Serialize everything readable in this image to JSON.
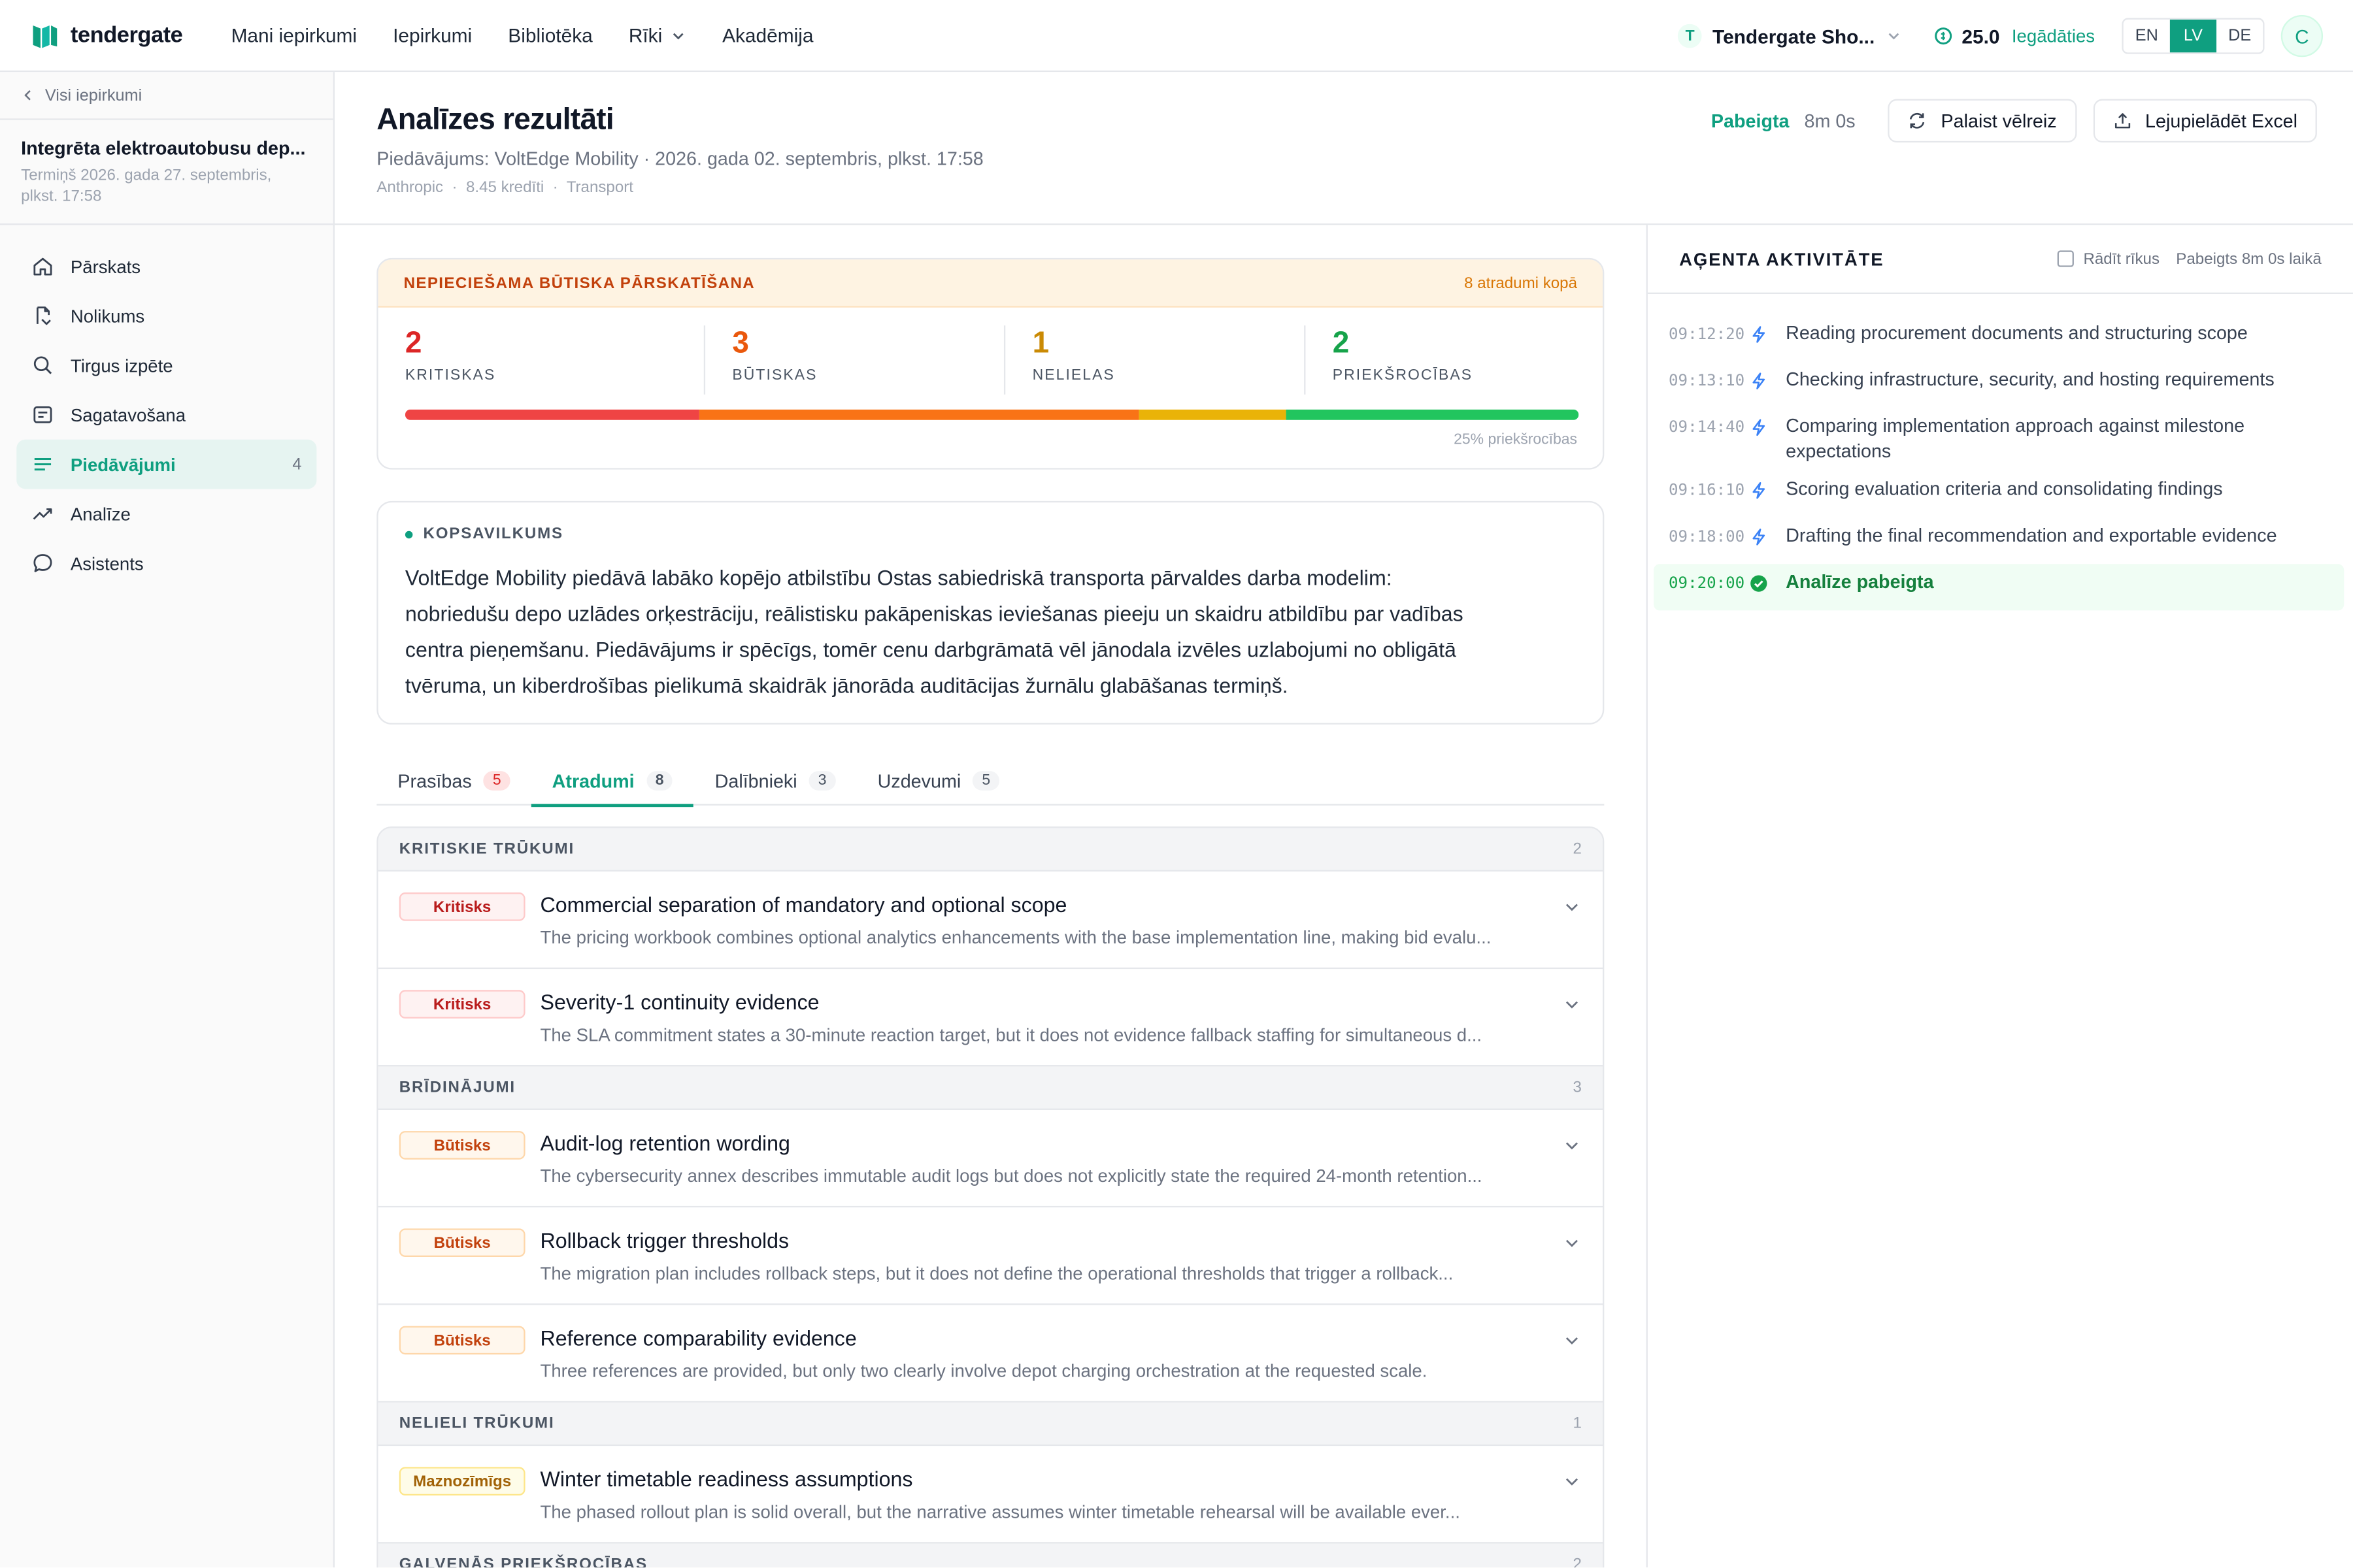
{
  "brand": {
    "name": "tendergate"
  },
  "nav": {
    "items": [
      "Mani iepirkumi",
      "Iepirkumi",
      "Bibliotēka",
      "Rīki",
      "Akadēmija"
    ]
  },
  "topright": {
    "org_initial": "T",
    "org_name": "Tendergate Sho...",
    "credits": "25.0",
    "topup": "Iegādāties",
    "langs": [
      "EN",
      "LV",
      "DE"
    ],
    "active_lang": "LV",
    "avatar": "C"
  },
  "sidebar": {
    "back": "Visi iepirkumi",
    "tender_title": "Integrēta elektroautobusu dep...",
    "tender_deadline": "Termiņš 2026. gada 27. septembris, plkst. 17:58",
    "items": [
      {
        "label": "Pārskats",
        "icon": "home-icon"
      },
      {
        "label": "Nolikums",
        "icon": "document-icon"
      },
      {
        "label": "Tirgus izpēte",
        "icon": "search-icon"
      },
      {
        "label": "Sagatavošana",
        "icon": "edit-icon"
      },
      {
        "label": "Piedāvājumi",
        "icon": "list-icon",
        "count": "4",
        "active": true
      },
      {
        "label": "Analīze",
        "icon": "trend-icon"
      },
      {
        "label": "Asistents",
        "icon": "chat-icon"
      }
    ]
  },
  "header": {
    "title": "Analīzes rezultāti",
    "subtitle": "Piedāvājums: VoltEdge Mobility · 2026. gada 02. septembris, plkst. 17:58",
    "meta": [
      "Anthropic",
      "8.45 kredīti",
      "Transport"
    ],
    "status": "Pabeigta",
    "duration": "8m 0s",
    "rerun": "Palaist vēlreiz",
    "download": "Lejupielādēt Excel"
  },
  "review": {
    "title": "NEPIECIEŠAMA BŪTISKA PĀRSKATĪŠANA",
    "total": "8 atradumi kopā",
    "severities": [
      {
        "value": "2",
        "label": "KRITISKAS",
        "color": "#dc2626"
      },
      {
        "value": "3",
        "label": "BŪTISKAS",
        "color": "#ea580c"
      },
      {
        "value": "1",
        "label": "NELIELAS",
        "color": "#ca8a04"
      },
      {
        "value": "2",
        "label": "PRIEKŠROCĪBAS",
        "color": "#16a34a"
      }
    ],
    "bar_colors": [
      "#ef4444",
      "#f97316",
      "#eab308",
      "#22c55e"
    ],
    "bar_note": "25% priekšrocības"
  },
  "summary": {
    "title": "KOPSAVILKUMS",
    "text": "VoltEdge Mobility piedāvā labāko kopējo atbilstību Ostas sabiedriskā transporta pārvaldes darba modelim: nobriedušu depo uzlādes orķestrāciju, reālistisku pakāpeniskas ieviešanas pieeju un skaidru atbildību par vadības centra pieņemšanu. Piedāvājums ir spēcīgs, tomēr cenu darbgrāmatā vēl jānodala izvēles uzlabojumi no obligātā tvēruma, un kiberdrošības pielikumā skaidrāk jānorāda auditācijas žurnālu glabāšanas termiņš."
  },
  "tabs": [
    {
      "label": "Prasības",
      "count": "5",
      "red": true
    },
    {
      "label": "Atradumi",
      "count": "8",
      "active": true
    },
    {
      "label": "Dalībnieki",
      "count": "3"
    },
    {
      "label": "Uzdevumi",
      "count": "5"
    }
  ],
  "findings": {
    "groups": [
      {
        "title": "KRITISKIE TRŪKUMI",
        "count": "2",
        "items": [
          {
            "severity": "Kritisks",
            "kind": "critical",
            "title": "Commercial separation of mandatory and optional scope",
            "desc": "The pricing workbook combines optional analytics enhancements with the base implementation line, making bid evalu..."
          },
          {
            "severity": "Kritisks",
            "kind": "critical",
            "title": "Severity-1 continuity evidence",
            "desc": "The SLA commitment states a 30-minute reaction target, but it does not evidence fallback staffing for simultaneous d..."
          }
        ]
      },
      {
        "title": "BRĪDINĀJUMI",
        "count": "3",
        "items": [
          {
            "severity": "Būtisks",
            "kind": "major",
            "title": "Audit-log retention wording",
            "desc": "The cybersecurity annex describes immutable audit logs but does not explicitly state the required 24-month retention..."
          },
          {
            "severity": "Būtisks",
            "kind": "major",
            "title": "Rollback trigger thresholds",
            "desc": "The migration plan includes rollback steps, but it does not define the operational thresholds that trigger a rollback..."
          },
          {
            "severity": "Būtisks",
            "kind": "major",
            "title": "Reference comparability evidence",
            "desc": "Three references are provided, but only two clearly involve depot charging orchestration at the requested scale."
          }
        ]
      },
      {
        "title": "NELIELI TRŪKUMI",
        "count": "1",
        "items": [
          {
            "severity": "Maznozīmīgs",
            "kind": "minor",
            "title": "Winter timetable readiness assumptions",
            "desc": "The phased rollout plan is solid overall, but the narrative assumes winter timetable rehearsal will be available ever..."
          }
        ]
      },
      {
        "title": "GALVENĀS PRIEKŠROCĪBAS",
        "count": "2",
        "items": []
      }
    ]
  },
  "activity": {
    "title": "AĢENTA AKTIVITĀTE",
    "show_tools": "Rādīt rīkus",
    "finished": "Pabeigts 8m 0s laikā",
    "rows": [
      {
        "time": "09:12:20",
        "text": "Reading procurement documents and structuring scope"
      },
      {
        "time": "09:13:10",
        "text": "Checking infrastructure, security, and hosting requirements"
      },
      {
        "time": "09:14:40",
        "text": "Comparing implementation approach against milestone expectations"
      },
      {
        "time": "09:16:10",
        "text": "Scoring evaluation criteria and consolidating findings"
      },
      {
        "time": "09:18:00",
        "text": "Drafting the final recommendation and exportable evidence"
      },
      {
        "time": "09:20:00",
        "text": "Analīze pabeigta",
        "done": true
      }
    ]
  }
}
